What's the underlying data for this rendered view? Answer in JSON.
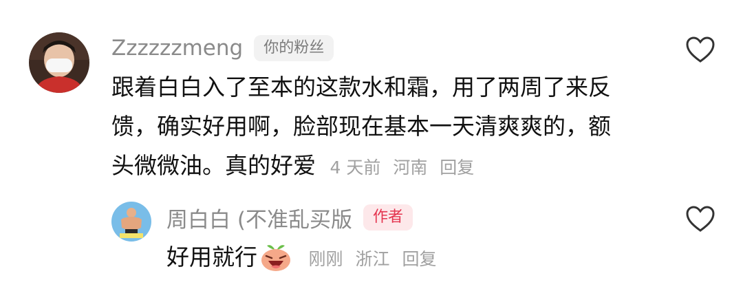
{
  "comments": [
    {
      "username": "Zzzzzzmeng",
      "badge": "你的粉丝",
      "text_lines": [
        "跟着白白入了至本的这款水和霜，用了两周了来反",
        "馈，确实好用啊，脸部现在基本一天清爽爽的，额",
        "头微微油。真的好爱"
      ],
      "time": "4 天前",
      "location": "河南",
      "reply_label": "回复"
    },
    {
      "username": "周白白 (不准乱买版",
      "badge": "作者",
      "text": "好用就行",
      "time": "刚刚",
      "location": "浙江",
      "reply_label": "回复"
    }
  ],
  "colors": {
    "username": "#8a8a8a",
    "body_text": "#111111",
    "meta": "#a0a0a0",
    "fan_badge_bg": "#f2f2f2",
    "author_badge_bg": "#fde8ea",
    "author_badge_text": "#e4344f"
  },
  "icons": {
    "like": "heart-outline-icon",
    "emoji": "laughing-peach-emoji-icon"
  }
}
